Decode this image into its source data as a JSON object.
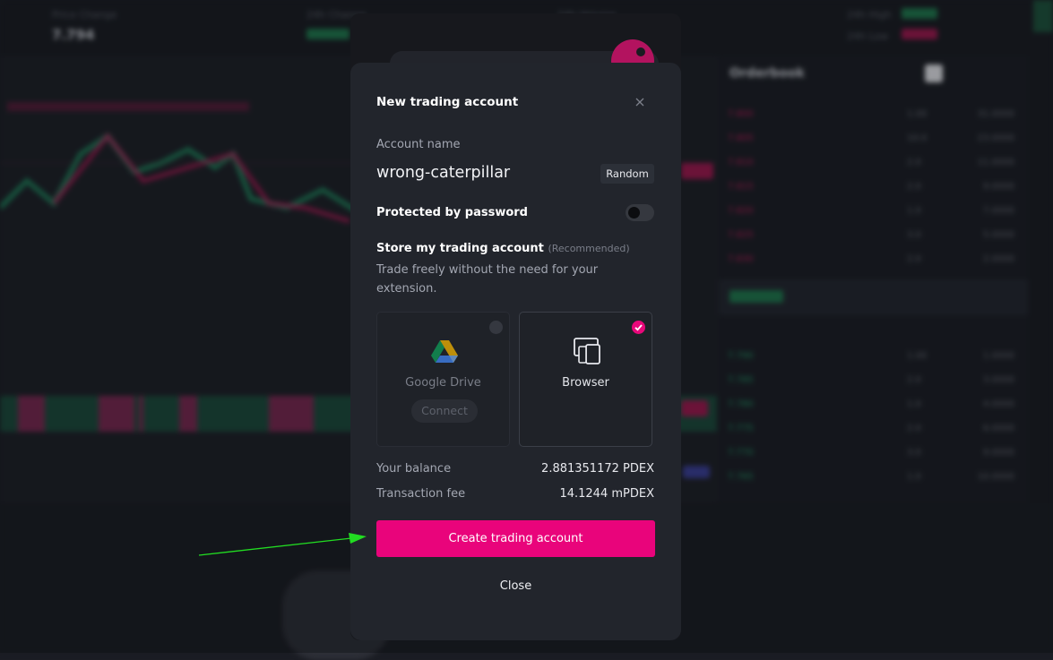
{
  "background": {
    "ticker_price": "7.794",
    "header_labels": [
      "Price Change",
      "24h Change",
      "24h Volume",
      "24h High",
      "24h Low"
    ],
    "orderbook_title": "Orderbook"
  },
  "modal": {
    "title": "New trading account",
    "close_icon": "close-icon",
    "account_name_label": "Account name",
    "account_name_value": "wrong-caterpillar",
    "random_button": "Random",
    "password_label": "Protected by password",
    "password_enabled": false,
    "store_label": "Store my trading account",
    "store_recommended": "(Recommended)",
    "store_description": "Trade freely without the need for your extension.",
    "options": [
      {
        "id": "google-drive",
        "label": "Google Drive",
        "action": "Connect",
        "selected": false,
        "icon": "google-drive-icon"
      },
      {
        "id": "browser",
        "label": "Browser",
        "selected": true,
        "icon": "browser-devices-icon"
      }
    ],
    "balance_label": "Your balance",
    "balance_value": "2.881351172 PDEX",
    "fee_label": "Transaction fee",
    "fee_value": "14.1244 mPDEX",
    "create_button": "Create trading account",
    "close_button": "Close"
  },
  "colors": {
    "accent": "#e9047b",
    "modal_bg": "#22252c",
    "annotation_arrow": "#22dd22"
  }
}
